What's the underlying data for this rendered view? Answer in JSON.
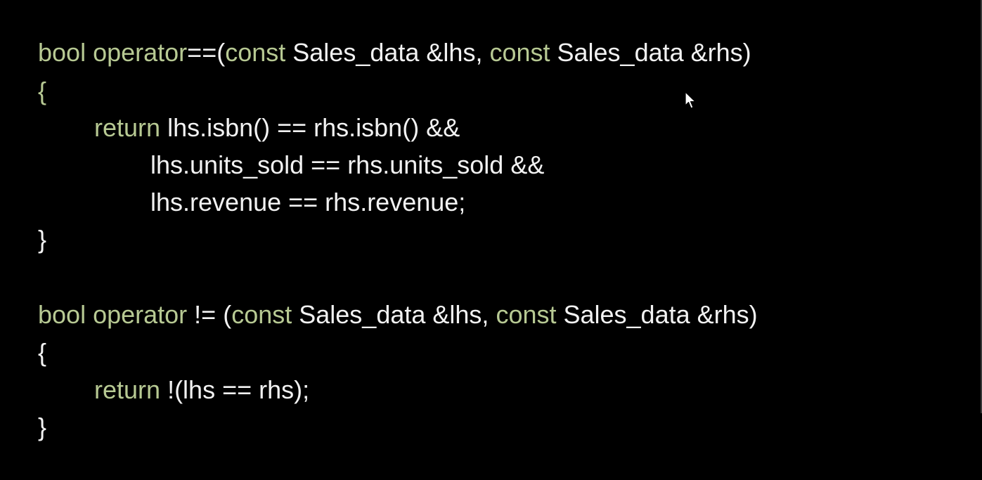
{
  "colors": {
    "background": "#000000",
    "keyword": "#b7c993",
    "text": "#f2f2f2"
  },
  "code": {
    "lines": [
      [
        {
          "t": "kw",
          "v": "bool operator"
        },
        {
          "t": "plain",
          "v": "==("
        },
        {
          "t": "kw",
          "v": "const"
        },
        {
          "t": "plain",
          "v": " Sales_data &lhs, "
        },
        {
          "t": "kw",
          "v": "const"
        },
        {
          "t": "plain",
          "v": " Sales_data &rhs)"
        }
      ],
      [
        {
          "t": "kw",
          "v": "{"
        }
      ],
      [
        {
          "t": "kw",
          "v": "return"
        },
        {
          "t": "plain",
          "v": " lhs.isbn() == rhs.isbn() &&"
        }
      ],
      [
        {
          "t": "plain",
          "v": "lhs.units_sold == rhs.units_sold &&"
        }
      ],
      [
        {
          "t": "plain",
          "v": "lhs.revenue == rhs.revenue;"
        }
      ],
      [
        {
          "t": "plain",
          "v": "}"
        }
      ],
      [],
      [
        {
          "t": "kw",
          "v": "bool operator"
        },
        {
          "t": "plain",
          "v": " != ("
        },
        {
          "t": "kw",
          "v": "const"
        },
        {
          "t": "plain",
          "v": " Sales_data &lhs, "
        },
        {
          "t": "kw",
          "v": "const"
        },
        {
          "t": "plain",
          "v": " Sales_data &rhs)"
        }
      ],
      [
        {
          "t": "plain",
          "v": "{"
        }
      ],
      [
        {
          "t": "kw",
          "v": "return"
        },
        {
          "t": "plain",
          "v": " !(lhs == rhs);"
        }
      ],
      [
        {
          "t": "plain",
          "v": "}"
        }
      ]
    ]
  },
  "cursor": {
    "icon": "mouse-pointer-icon"
  }
}
